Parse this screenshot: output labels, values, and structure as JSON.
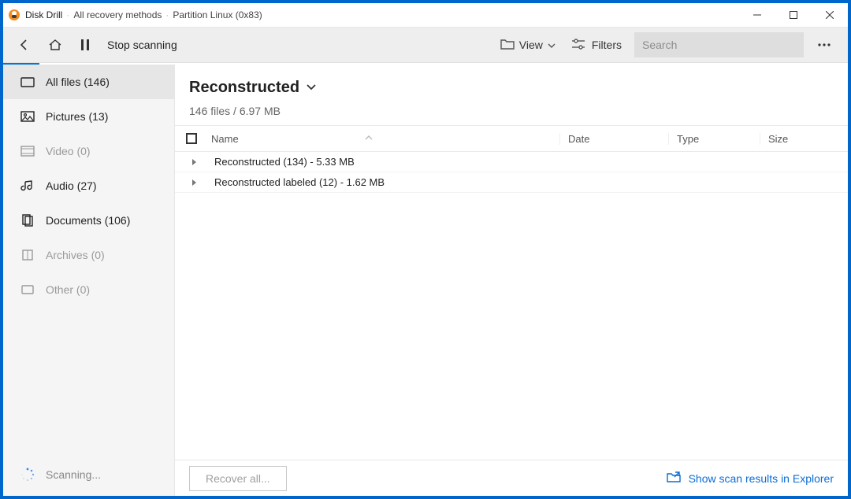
{
  "titlebar": {
    "app_name": "Disk Drill",
    "separator": "·",
    "crumb1": "All recovery methods",
    "crumb2": "Partition Linux (0x83)"
  },
  "toolbar": {
    "stop_label": "Stop scanning",
    "view_label": "View",
    "filters_label": "Filters",
    "search_placeholder": "Search"
  },
  "sidebar": {
    "items": [
      {
        "id": "all-files",
        "label": "All files (146)",
        "icon": "folder-icon",
        "active": true,
        "highlight": true
      },
      {
        "id": "pictures",
        "label": "Pictures (13)",
        "icon": "pictures-icon",
        "active": false,
        "highlight": true
      },
      {
        "id": "video",
        "label": "Video (0)",
        "icon": "video-icon",
        "active": false,
        "highlight": false
      },
      {
        "id": "audio",
        "label": "Audio (27)",
        "icon": "audio-icon",
        "active": false,
        "highlight": true
      },
      {
        "id": "documents",
        "label": "Documents (106)",
        "icon": "documents-icon",
        "active": false,
        "highlight": true
      },
      {
        "id": "archives",
        "label": "Archives (0)",
        "icon": "archives-icon",
        "active": false,
        "highlight": false
      },
      {
        "id": "other",
        "label": "Other (0)",
        "icon": "other-icon",
        "active": false,
        "highlight": false
      }
    ],
    "status_label": "Scanning..."
  },
  "main": {
    "title": "Reconstructed",
    "subtitle": "146 files / 6.97 MB",
    "columns": {
      "name": "Name",
      "date": "Date",
      "type": "Type",
      "size": "Size"
    },
    "rows": [
      {
        "label": "Reconstructed (134) - 5.33 MB"
      },
      {
        "label": "Reconstructed labeled (12) - 1.62 MB"
      }
    ]
  },
  "bottom": {
    "recover_label": "Recover all...",
    "explorer_label": "Show scan results in Explorer"
  }
}
